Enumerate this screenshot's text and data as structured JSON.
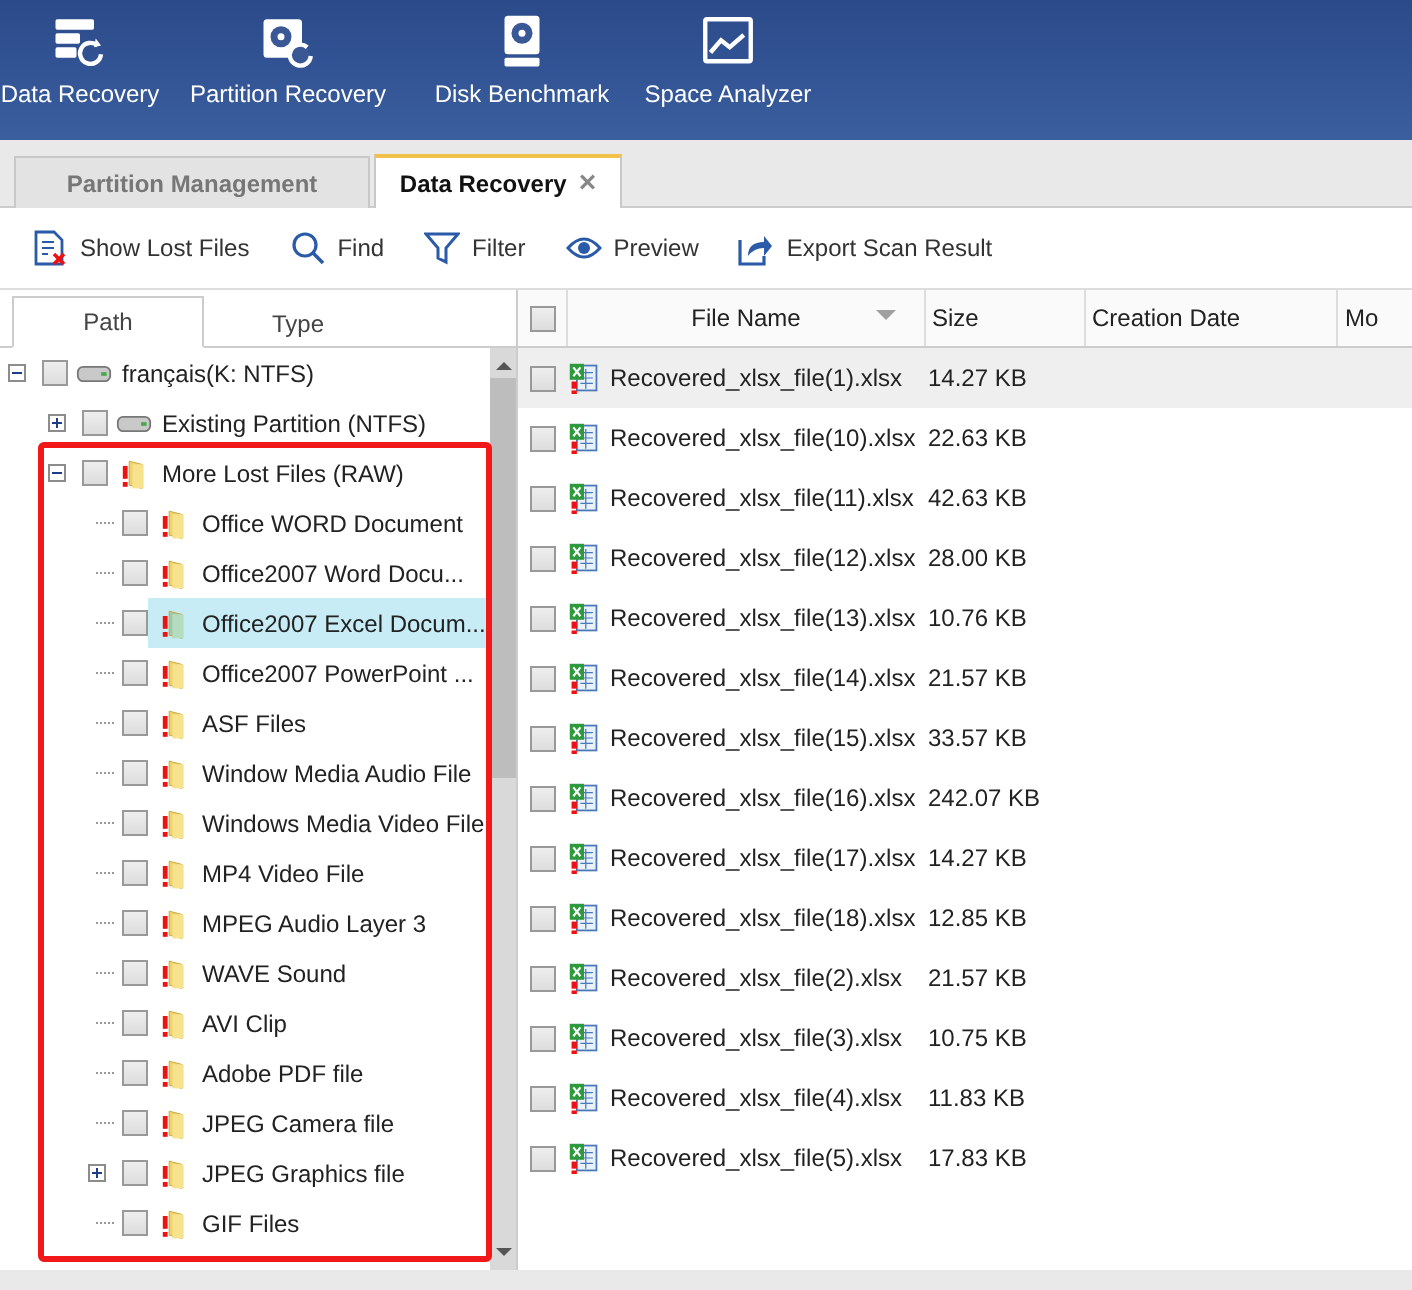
{
  "ribbon": [
    {
      "label": "Data Recovery",
      "kind": "data"
    },
    {
      "label": "Partition Recovery",
      "kind": "partition"
    },
    {
      "label": "Disk Benchmark",
      "kind": "disk"
    },
    {
      "label": "Space Analyzer",
      "kind": "space"
    }
  ],
  "tabs": [
    {
      "label": "Partition Management",
      "selected": false
    },
    {
      "label": "Data Recovery",
      "selected": true,
      "close": "×"
    }
  ],
  "toolbar": [
    {
      "label": "Show Lost Files",
      "kind": "lost"
    },
    {
      "label": "Find",
      "kind": "find"
    },
    {
      "label": "Filter",
      "kind": "filter"
    },
    {
      "label": "Preview",
      "kind": "preview"
    },
    {
      "label": "Export Scan Result",
      "kind": "export"
    }
  ],
  "pane_tabs": [
    {
      "label": "Path",
      "selected": true
    },
    {
      "label": "Type",
      "selected": false
    }
  ],
  "tree": [
    {
      "label": "français(K: NTFS)",
      "kind": "drive",
      "expanded": true,
      "checked": false,
      "selected": false,
      "children": [
        {
          "label": "Existing Partition (NTFS)",
          "kind": "drive",
          "expanded": false,
          "checked": false,
          "selected": false
        },
        {
          "label": "More Lost Files (RAW)",
          "kind": "folder",
          "expanded": true,
          "checked": false,
          "selected": false,
          "children": [
            {
              "label": "Office WORD Document",
              "kind": "folder",
              "checked": false,
              "selected": false
            },
            {
              "label": "Office2007 Word Docu...",
              "kind": "folder",
              "checked": false,
              "selected": false
            },
            {
              "label": "Office2007 Excel Docum...",
              "kind": "folder",
              "checked": false,
              "selected": true
            },
            {
              "label": "Office2007 PowerPoint ...",
              "kind": "folder",
              "checked": false,
              "selected": false
            },
            {
              "label": "ASF Files",
              "kind": "folder",
              "checked": false,
              "selected": false
            },
            {
              "label": "Window Media Audio File",
              "kind": "folder",
              "checked": false,
              "selected": false
            },
            {
              "label": "Windows Media Video File",
              "kind": "folder",
              "checked": false,
              "selected": false
            },
            {
              "label": "MP4 Video File",
              "kind": "folder",
              "checked": false,
              "selected": false
            },
            {
              "label": "MPEG Audio Layer 3",
              "kind": "folder",
              "checked": false,
              "selected": false
            },
            {
              "label": "WAVE Sound",
              "kind": "folder",
              "checked": false,
              "selected": false
            },
            {
              "label": "AVI Clip",
              "kind": "folder",
              "checked": false,
              "selected": false
            },
            {
              "label": "Adobe PDF file",
              "kind": "folder",
              "checked": false,
              "selected": false
            },
            {
              "label": "JPEG Camera file",
              "kind": "folder",
              "checked": false,
              "selected": false
            },
            {
              "label": "JPEG Graphics file",
              "kind": "folder",
              "expanded": false,
              "checked": false,
              "selected": false
            },
            {
              "label": "GIF Files",
              "kind": "folder",
              "checked": false,
              "selected": false
            }
          ]
        }
      ]
    }
  ],
  "table": {
    "all_checked": false,
    "columns": [
      "File Name",
      "Size",
      "Creation Date",
      "Mo"
    ],
    "rows": [
      {
        "name": "Recovered_xlsx_file(1).xlsx",
        "size": "14.27 KB",
        "checked": false,
        "selected": true
      },
      {
        "name": "Recovered_xlsx_file(10).xlsx",
        "size": "22.63 KB",
        "checked": false,
        "selected": false
      },
      {
        "name": "Recovered_xlsx_file(11).xlsx",
        "size": "42.63 KB",
        "checked": false,
        "selected": false
      },
      {
        "name": "Recovered_xlsx_file(12).xlsx",
        "size": "28.00 KB",
        "checked": false,
        "selected": false
      },
      {
        "name": "Recovered_xlsx_file(13).xlsx",
        "size": "10.76 KB",
        "checked": false,
        "selected": false
      },
      {
        "name": "Recovered_xlsx_file(14).xlsx",
        "size": "21.57 KB",
        "checked": false,
        "selected": false
      },
      {
        "name": "Recovered_xlsx_file(15).xlsx",
        "size": "33.57 KB",
        "checked": false,
        "selected": false
      },
      {
        "name": "Recovered_xlsx_file(16).xlsx",
        "size": "242.07 KB",
        "checked": false,
        "selected": false
      },
      {
        "name": "Recovered_xlsx_file(17).xlsx",
        "size": "14.27 KB",
        "checked": false,
        "selected": false
      },
      {
        "name": "Recovered_xlsx_file(18).xlsx",
        "size": "12.85 KB",
        "checked": false,
        "selected": false
      },
      {
        "name": "Recovered_xlsx_file(2).xlsx",
        "size": "21.57 KB",
        "checked": false,
        "selected": false
      },
      {
        "name": "Recovered_xlsx_file(3).xlsx",
        "size": "10.75 KB",
        "checked": false,
        "selected": false
      },
      {
        "name": "Recovered_xlsx_file(4).xlsx",
        "size": "11.83 KB",
        "checked": false,
        "selected": false
      },
      {
        "name": "Recovered_xlsx_file(5).xlsx",
        "size": "17.83 KB",
        "checked": false,
        "selected": false
      }
    ]
  }
}
